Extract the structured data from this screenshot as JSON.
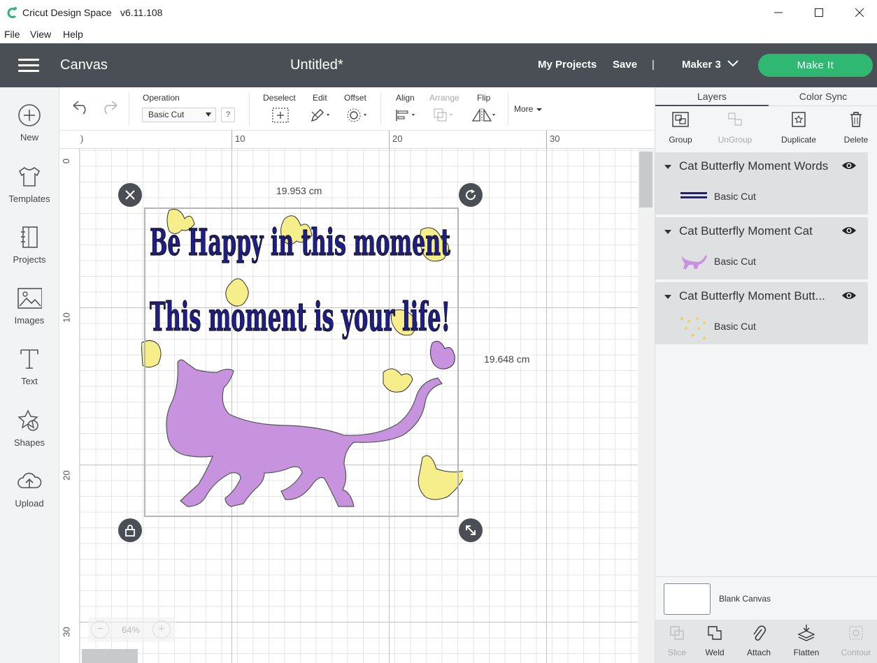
{
  "window": {
    "app_name": "Cricut Design Space",
    "version": "v6.11.108"
  },
  "menu": [
    "File",
    "View",
    "Help"
  ],
  "header": {
    "section_title": "Canvas",
    "document_title": "Untitled*",
    "my_projects": "My Projects",
    "save": "Save",
    "divider": "|",
    "machine": "Maker 3",
    "make_it": "Make It"
  },
  "sidebar": {
    "items": [
      {
        "label": "New",
        "icon": "plus-circle-icon"
      },
      {
        "label": "Templates",
        "icon": "tshirt-icon"
      },
      {
        "label": "Projects",
        "icon": "notebook-icon"
      },
      {
        "label": "Images",
        "icon": "image-icon"
      },
      {
        "label": "Text",
        "icon": "text-icon"
      },
      {
        "label": "Shapes",
        "icon": "shapes-icon"
      },
      {
        "label": "Upload",
        "icon": "cloud-upload-icon"
      }
    ]
  },
  "toolbar": {
    "operation_label": "Operation",
    "operation_value": "Basic Cut",
    "help": "?",
    "deselect": "Deselect",
    "edit": "Edit",
    "offset": "Offset",
    "align": "Align",
    "arrange": "Arrange",
    "flip": "Flip",
    "more": "More"
  },
  "canvas": {
    "ruler_top": [
      ")",
      "10",
      "20",
      "30"
    ],
    "ruler_left": [
      "0",
      "10",
      "20",
      "30"
    ],
    "width_label": "19.953 cm",
    "height_label": "19.648 cm",
    "zoom": "64%",
    "zoom_minus": "−",
    "zoom_plus": "+",
    "design_text_line1": "Be Happy in this moment",
    "design_text_line2": "This moment is your life!",
    "colors": {
      "text": "#1f1e86",
      "cat": "#c792de",
      "butterfly": "#f6ee8a"
    }
  },
  "layers_panel": {
    "tabs": [
      "Layers",
      "Color Sync"
    ],
    "actions": [
      {
        "label": "Group",
        "enabled": true
      },
      {
        "label": "UnGroup",
        "enabled": false
      },
      {
        "label": "Duplicate",
        "enabled": true
      },
      {
        "label": "Delete",
        "enabled": true
      }
    ],
    "layers": [
      {
        "name": "Cat Butterfly Moment Words",
        "operation": "Basic Cut"
      },
      {
        "name": "Cat Butterfly Moment Cat",
        "operation": "Basic Cut"
      },
      {
        "name": "Cat Butterfly Moment Butt...",
        "operation": "Basic Cut"
      }
    ],
    "blank_canvas": "Blank Canvas",
    "bottom_actions": [
      {
        "label": "Slice",
        "enabled": false
      },
      {
        "label": "Weld",
        "enabled": true
      },
      {
        "label": "Attach",
        "enabled": true
      },
      {
        "label": "Flatten",
        "enabled": true
      },
      {
        "label": "Contour",
        "enabled": false
      }
    ]
  }
}
